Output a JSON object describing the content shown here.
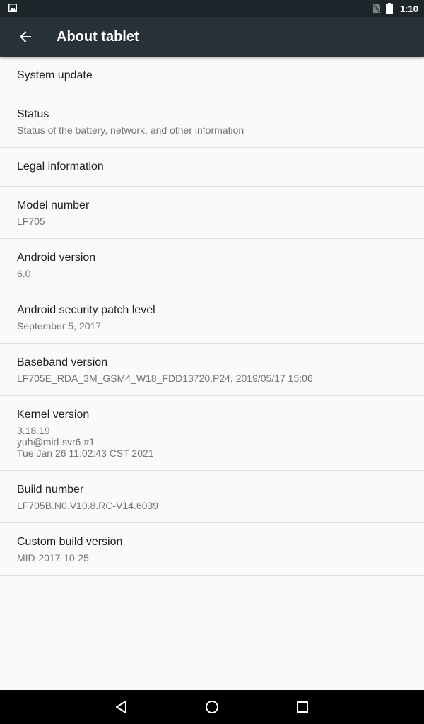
{
  "status_bar": {
    "time": "1:10",
    "icons": [
      "image-notification-icon",
      "no-sim-icon",
      "battery-icon"
    ]
  },
  "app_bar": {
    "title": "About tablet",
    "back_icon": "arrow-back-icon"
  },
  "items": [
    {
      "title": "System update"
    },
    {
      "title": "Status",
      "summary": "Status of the battery, network, and other information"
    },
    {
      "title": "Legal information"
    },
    {
      "title": "Model number",
      "summary": "LF705"
    },
    {
      "title": "Android version",
      "summary": "6.0"
    },
    {
      "title": "Android security patch level",
      "summary": "September 5, 2017"
    },
    {
      "title": "Baseband version",
      "summary": "LF705E_RDA_3M_GSM4_W18_FDD13720.P24, 2019/05/17 15:06"
    },
    {
      "title": "Kernel version",
      "summary": "3.18.19\nyuh@mid-svr6 #1\nTue Jan 26 11:02:43 CST 2021"
    },
    {
      "title": "Build number",
      "summary": "LF705B.N0.V10.8.RC-V14.6039"
    },
    {
      "title": "Custom build version",
      "summary": "MID-2017-10-25"
    }
  ],
  "nav_bar": {
    "icons": [
      "back-triangle-icon",
      "home-circle-icon",
      "recents-square-icon"
    ]
  },
  "colors": {
    "status_bar": "#1c252a",
    "app_bar": "#263238",
    "background": "#fafafa",
    "divider": "#dcdcdc",
    "primary_text": "#212121",
    "secondary_text": "#737373"
  }
}
